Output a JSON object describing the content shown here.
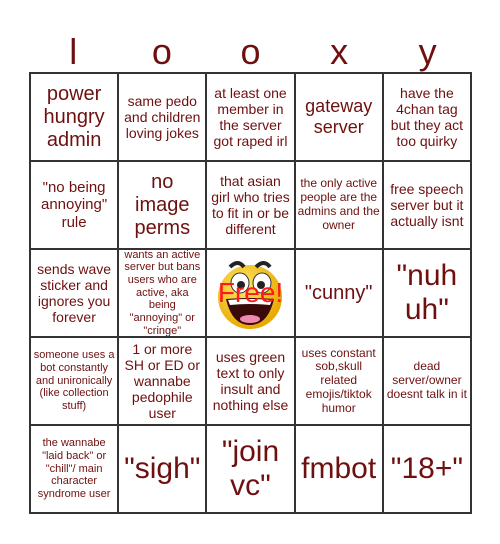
{
  "title_letters": [
    "l",
    "o",
    "o",
    "x",
    "y"
  ],
  "colors": {
    "text": "#6e1010",
    "free": "#ff1a1a",
    "border": "#333333"
  },
  "cells": [
    "power hungry admin",
    "same pedo and children loving jokes",
    "at least one member in the server got raped irl",
    "gateway server",
    "have the 4chan tag but they act too quirky",
    "\"no being annoying\" rule",
    "no image perms",
    "that asian girl who tries to fit in or be different",
    "the only active people are the admins and the owner",
    "free speech server but it actually isnt",
    "sends wave sticker and ignores you forever",
    "wants an active server but bans users who are active, aka being \"annoying\" or \"cringe\"",
    "Free!",
    "\"cunny\"",
    "\"nuh uh\"",
    "someone uses a bot constantly and unironically (like collection stuff)",
    "1 or more SH or ED or wannabe pedophile user",
    "uses green text to only insult and nothing else",
    "uses constant sob,skull related emojis/tiktok humor",
    "dead server/owner doesnt talk in it",
    "the wannabe \"laid back\" or \"chill\"/ main character syndrome user",
    "\"sigh\"",
    "\"join vc\"",
    "fmbot",
    "\"18+\""
  ],
  "free_icon": "laughing-emoji-icon"
}
